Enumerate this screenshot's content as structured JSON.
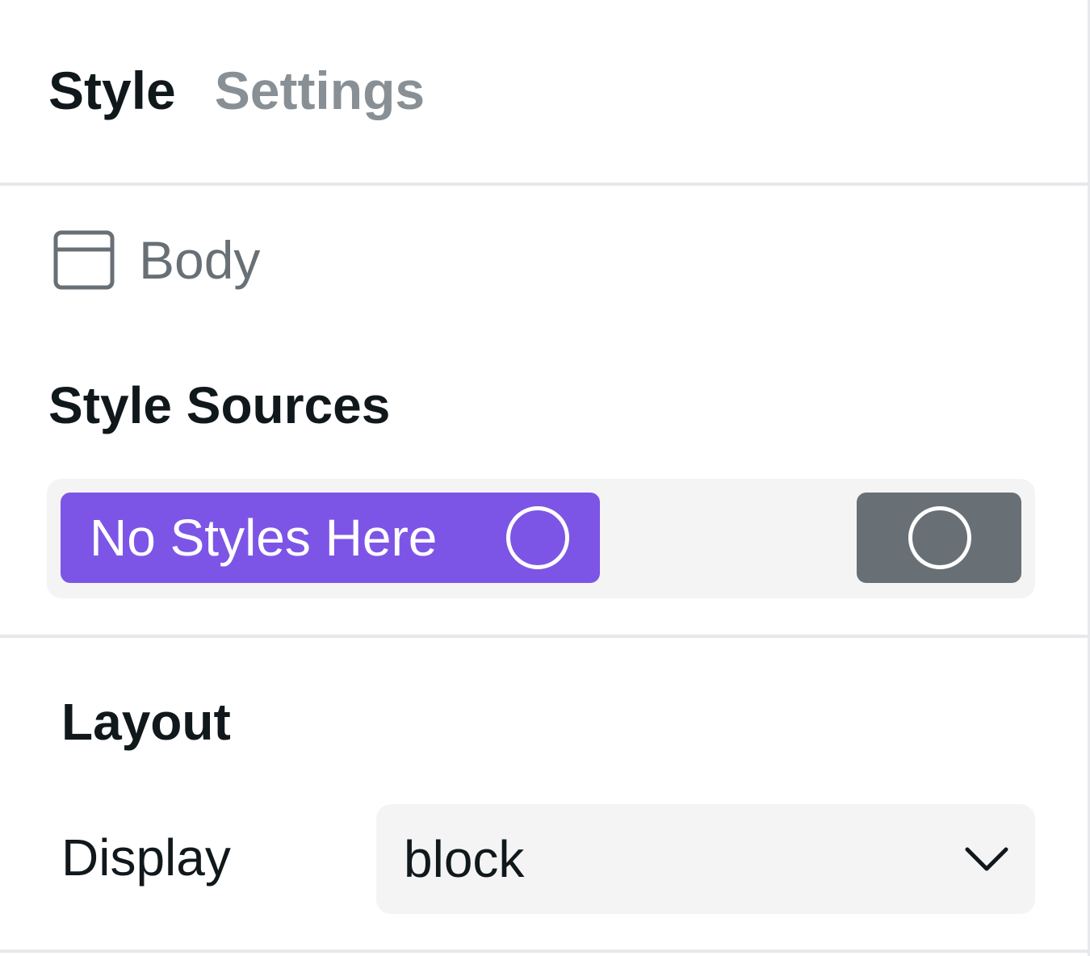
{
  "tabs": [
    {
      "label": "Style",
      "active": true
    },
    {
      "label": "Settings",
      "active": false
    }
  ],
  "element": {
    "icon": "body-layout-icon",
    "label": "Body"
  },
  "style_sources": {
    "title": "Style Sources",
    "token_label": "No Styles Here",
    "token_color": "#7d55e6",
    "state_button_color": "#687076"
  },
  "layout": {
    "title": "Layout",
    "display_label": "Display",
    "display_value": "block"
  }
}
